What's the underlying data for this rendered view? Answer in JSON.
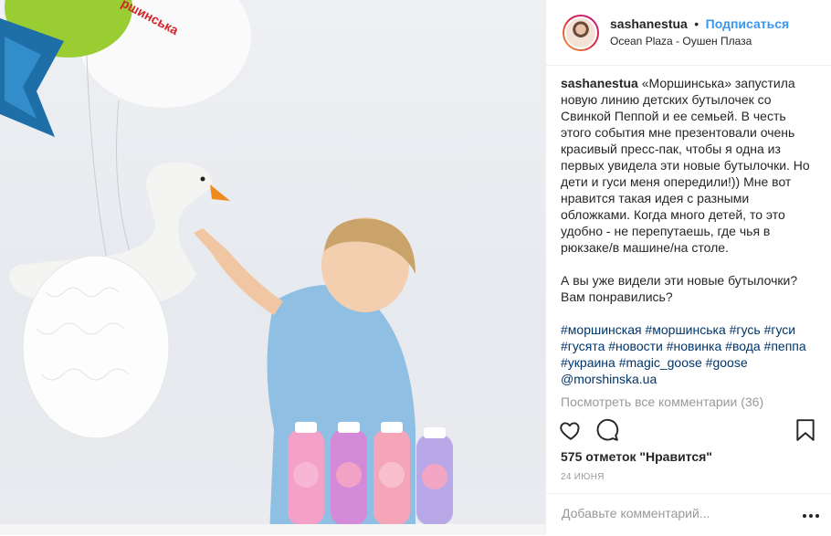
{
  "post": {
    "username": "sashanestua",
    "separator": "•",
    "follow_label": "Подписаться",
    "location": "Ocean Plaza - Оушен Плаза",
    "caption": "«Моршинська» запустила новую линию детских бутылочек со Свинкой Пеппой и ее семьей. В честь этого события мне презентовали очень красивый пресс-пак, чтобы я одна из первых увидела эти новые бутылочки. Но дети и гуси меня опередили!)) Мне вот нравится такая идея с разными обложками. Когда много детей, то это удобно - не перепутаешь, где чья в рюкзаке/в машине/на столе.\n\nА вы уже видели эти новые бутылочки? Вам понравились?",
    "hashtags": [
      "#моршинская",
      "#моршинська",
      "#гусь",
      "#гуси",
      "#гусята",
      "#новости",
      "#новинка",
      "#вода",
      "#пеппа",
      "#украина",
      "#magic_goose",
      "#goose",
      "@morshinska.ua"
    ],
    "view_all_comments": "Посмотреть все комментарии (36)",
    "likes": "575 отметок \"Нравится\"",
    "date": "24 ИЮНЯ",
    "comment_placeholder": "Добавьте комментарий...",
    "photo_watermark": "ршинська"
  },
  "colors": {
    "accent": "#3897f0",
    "hashtag": "#003569",
    "muted": "#999999"
  },
  "icons": [
    "heart-icon",
    "comment-icon",
    "bookmark-icon",
    "more-options-icon"
  ]
}
